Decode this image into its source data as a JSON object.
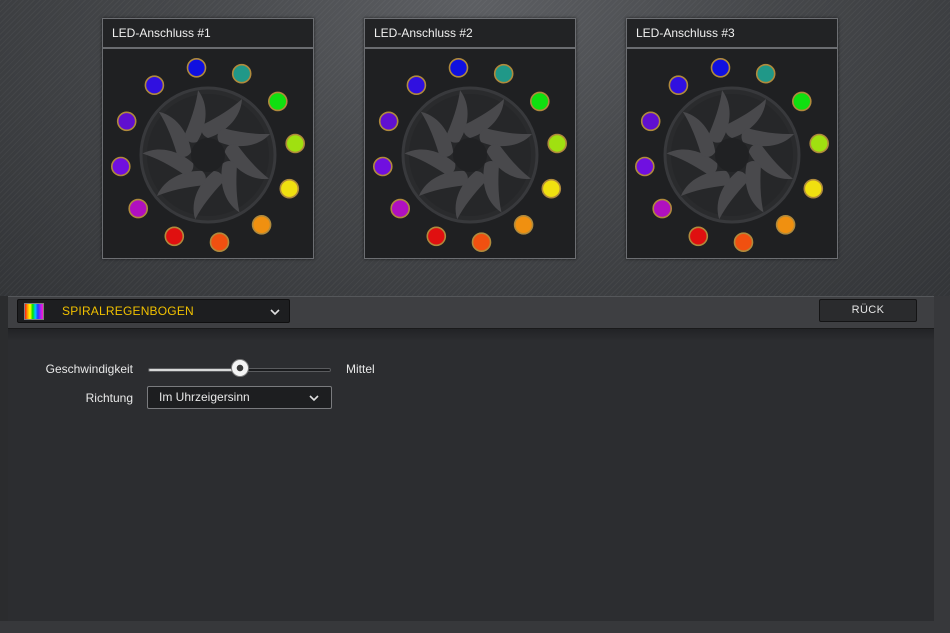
{
  "panels": [
    {
      "title": "LED-Anschluss #1"
    },
    {
      "title": "LED-Anschluss #2"
    },
    {
      "title": "LED-Anschluss #3"
    }
  ],
  "led_colors": [
    "#1010e0",
    "#209888",
    "#10e010",
    "#a0e010",
    "#f0e010",
    "#f09010",
    "#f05010",
    "#e01010",
    "#b010c0",
    "#7010e0",
    "#6010d0",
    "#3010e0"
  ],
  "effect": {
    "label": "SPIRALREGENBOGEN",
    "icon": "rainbow-swatch-icon"
  },
  "back_button": {
    "label": "RÜCK"
  },
  "settings": {
    "speed": {
      "label": "Geschwindigkeit",
      "value_label": "Mittel",
      "level": 0.5
    },
    "direction": {
      "label": "Richtung",
      "value": "Im Uhrzeigersinn"
    }
  },
  "colors": {
    "accent": "#f0c000",
    "panel_bg": "#1f2022",
    "content_bg": "#2c2d30"
  }
}
